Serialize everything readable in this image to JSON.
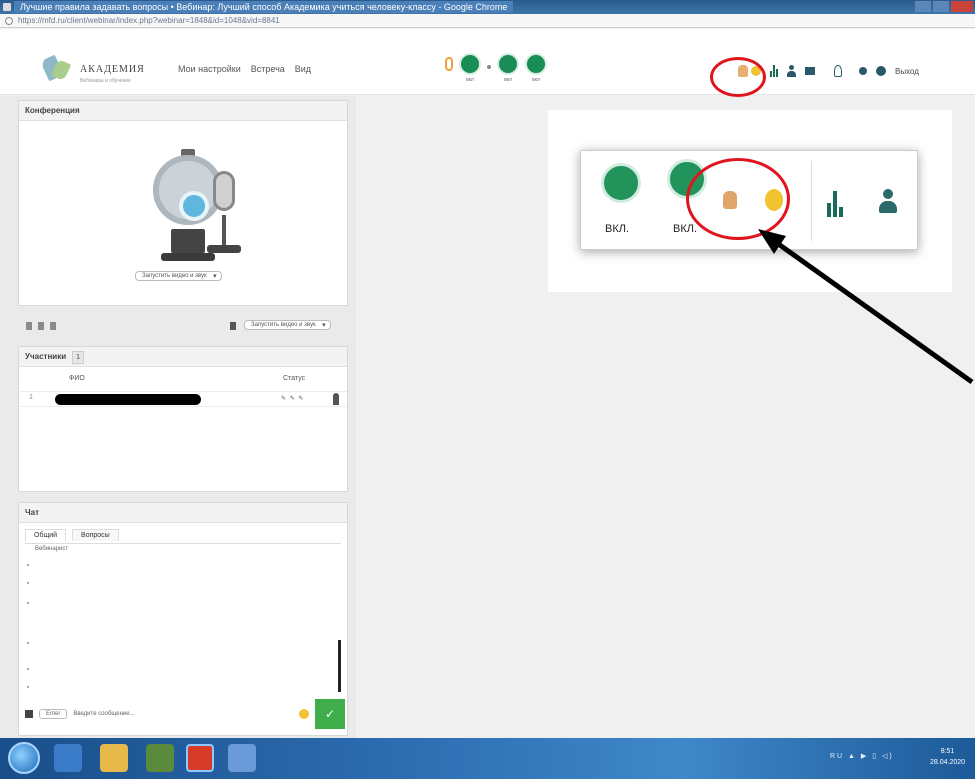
{
  "browser": {
    "tab_title": "Лучшие правила задавать вопросы • Вебинар: Лучший способ Академика учиться человеку-классу - Google Chrome",
    "url": "https://mfd.ru/client/webinar/index.php?webinar=1848&id=1048&vid=8841"
  },
  "header": {
    "brand": "АКАДЕМИЯ",
    "brand_sub": "Вебинары и обучение",
    "nav": [
      "Мои настройки",
      "Встреча",
      "Вид"
    ],
    "media_labels": [
      "вкл",
      "вкл",
      "вкл"
    ],
    "exit_label": "Выход"
  },
  "conference": {
    "title": "Конференция",
    "video_select": "Запустить видео и звук",
    "video_select2": "Запустить видео и звук"
  },
  "participants": {
    "title": "Участники",
    "count": "1",
    "col_name": "ФИО",
    "col_status": "Статус",
    "rows": [
      {
        "num": "1",
        "status": "✎ ✎ ✎"
      }
    ]
  },
  "chat": {
    "title": "Чат",
    "tabs": [
      "Общий",
      "Вопросы"
    ],
    "first_msg": "Вебинарист",
    "lang": "Enter",
    "input_placeholder": "Введите сообщение...",
    "send_label": "✓"
  },
  "zoom_panel": {
    "btn1_label": "ВКЛ.",
    "btn2_label": "ВКЛ."
  },
  "taskbar": {
    "tray": "RU ▲ ▶ ▯ ◁)",
    "time": "8:51",
    "date": "28.04.2020"
  },
  "colors": {
    "accent_green": "#22935a",
    "highlight_red": "#e0141e"
  }
}
